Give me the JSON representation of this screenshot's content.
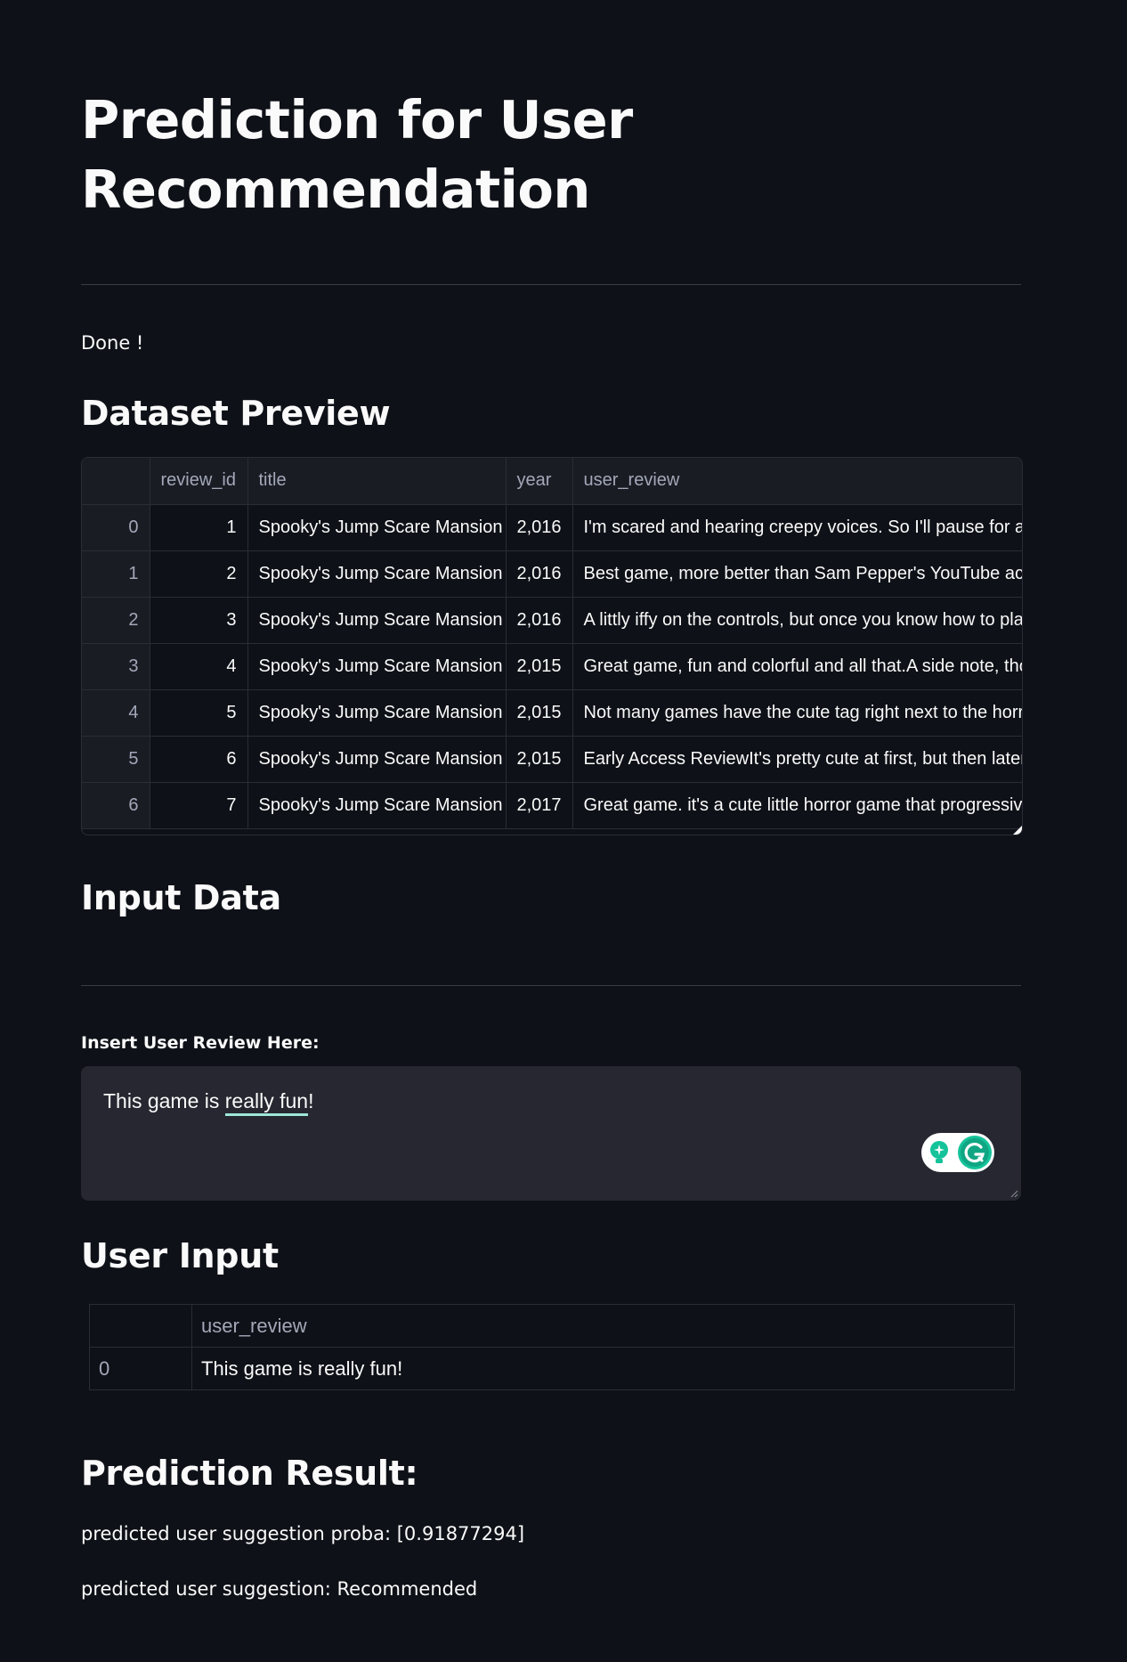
{
  "page": {
    "title": "Prediction for User Recommendation",
    "status_text": "Done !"
  },
  "dataset_preview": {
    "heading": "Dataset Preview",
    "columns": [
      "",
      "review_id",
      "title",
      "year",
      "user_review"
    ],
    "rows": [
      {
        "index": "0",
        "review_id": "1",
        "title": "Spooky's Jump Scare Mansion",
        "year": "2,016",
        "user_review": "I'm scared and hearing creepy voices.  So I'll pause for a m"
      },
      {
        "index": "1",
        "review_id": "2",
        "title": "Spooky's Jump Scare Mansion",
        "year": "2,016",
        "user_review": "Best game, more better than Sam Pepper's YouTube acco"
      },
      {
        "index": "2",
        "review_id": "3",
        "title": "Spooky's Jump Scare Mansion",
        "year": "2,016",
        "user_review": "A littly iffy on the controls, but once you know how to pla"
      },
      {
        "index": "3",
        "review_id": "4",
        "title": "Spooky's Jump Scare Mansion",
        "year": "2,015",
        "user_review": "Great game, fun and colorful and all that.A side note, tho"
      },
      {
        "index": "4",
        "review_id": "5",
        "title": "Spooky's Jump Scare Mansion",
        "year": "2,015",
        "user_review": "Not many games have the cute tag right next to the horro"
      },
      {
        "index": "5",
        "review_id": "6",
        "title": "Spooky's Jump Scare Mansion",
        "year": "2,015",
        "user_review": "Early Access ReviewIt's pretty cute at first, but then later"
      },
      {
        "index": "6",
        "review_id": "7",
        "title": "Spooky's Jump Scare Mansion",
        "year": "2,017",
        "user_review": "Great game. it's a cute little horror game that progressive"
      }
    ]
  },
  "input_section": {
    "heading": "Input Data",
    "label": "Insert User Review Here:",
    "value_prefix": "This game is ",
    "value_underlined": "really fun",
    "value_suffix": "!"
  },
  "user_input": {
    "heading": "User Input",
    "column": "user_review",
    "rows": [
      {
        "index": "0",
        "user_review": "This game is really fun!"
      }
    ]
  },
  "result": {
    "heading": "Prediction Result:",
    "proba_text": "predicted user suggestion proba: [0.91877294]",
    "suggestion_text": "predicted user suggestion: Recommended"
  },
  "colors": {
    "background": "#0e1117",
    "text": "#fafafa",
    "muted": "#a3a8b8",
    "input_bg": "#262730",
    "grammarly": "#15c39a"
  }
}
